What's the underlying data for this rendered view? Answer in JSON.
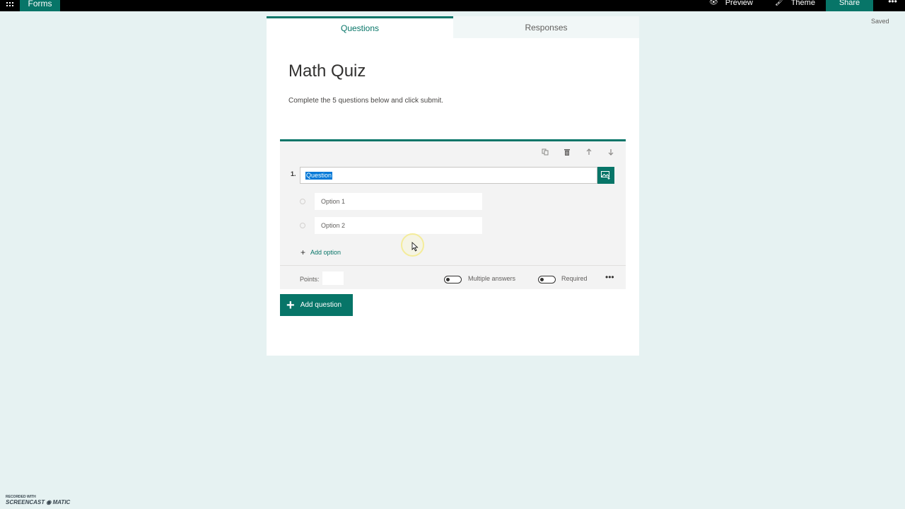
{
  "topbar": {
    "app_name": "Forms",
    "preview_label": "Preview",
    "theme_label": "Theme",
    "share_label": "Share",
    "more_label": "•••"
  },
  "status": {
    "saved": "Saved"
  },
  "tabs": [
    {
      "label": "Questions",
      "active": true
    },
    {
      "label": "Responses",
      "active": false
    }
  ],
  "form": {
    "title": "Math Quiz",
    "description": "Complete the 5 questions below and click submit."
  },
  "question": {
    "number": "1.",
    "text": "Question",
    "options": [
      "Option 1",
      "Option 2"
    ],
    "add_option_label": "Add option",
    "points_label": "Points:",
    "points_value": "",
    "multiple_answers_label": "Multiple answers",
    "required_label": "Required",
    "more_label": "•••"
  },
  "actions": {
    "add_question_label": "Add question"
  },
  "watermark": {
    "line1": "RECORDED WITH",
    "line2": "SCREENCAST",
    "line3": "MATIC"
  },
  "colors": {
    "accent": "#077568",
    "background": "#e6f2f2",
    "selection": "#0078d7"
  }
}
